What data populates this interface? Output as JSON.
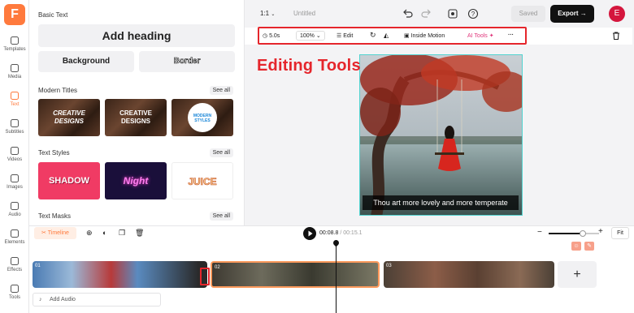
{
  "app": {
    "logo_letter": "F"
  },
  "rail": {
    "items": [
      {
        "label": "Templates",
        "icon": "templates-icon"
      },
      {
        "label": "Media",
        "icon": "media-icon"
      },
      {
        "label": "Text",
        "icon": "text-icon",
        "active": true
      },
      {
        "label": "Subtitles",
        "icon": "subtitles-icon"
      },
      {
        "label": "Videos",
        "icon": "videos-icon"
      },
      {
        "label": "Images",
        "icon": "images-icon"
      },
      {
        "label": "Audio",
        "icon": "audio-icon"
      },
      {
        "label": "Elements",
        "icon": "elements-icon"
      },
      {
        "label": "Effects",
        "icon": "effects-icon"
      },
      {
        "label": "Tools",
        "icon": "tools-icon"
      }
    ]
  },
  "panel": {
    "basic_text_title": "Basic Text",
    "add_heading": "Add heading",
    "background": "Background",
    "border": "Border",
    "modern_titles": "Modern Titles",
    "modern_titles_thumbs": [
      "CREATIVE DESIGNS",
      "CREATIVE DESIGNS",
      "MODERN STYLES"
    ],
    "text_styles": "Text Styles",
    "text_styles_thumbs": [
      "SHADOW",
      "Night",
      "JUICE"
    ],
    "text_masks": "Text Masks",
    "see_all": "See all"
  },
  "topbar": {
    "ratio": "1:1",
    "title": "Untitled",
    "saved": "Saved",
    "export": "Export",
    "avatar": "E"
  },
  "toolbar": {
    "duration": "5.0s",
    "zoom": "100%",
    "edit": "Edit",
    "inside_motion": "Inside Motion",
    "ai_tools": "AI Tools"
  },
  "canvas": {
    "annotation": "Editing Tools",
    "caption": "Thou art more lovely and more temperate"
  },
  "timeline": {
    "tab": "Timeline",
    "current_time": "00:08.8",
    "total_time": "/ 00:15.1",
    "fit": "Fit",
    "clips": [
      "01",
      "02",
      "03"
    ],
    "add_audio": "Add Audio"
  },
  "colors": {
    "accent": "#ff7a3d",
    "highlight": "#e5262c",
    "selection": "#52d3d0"
  }
}
